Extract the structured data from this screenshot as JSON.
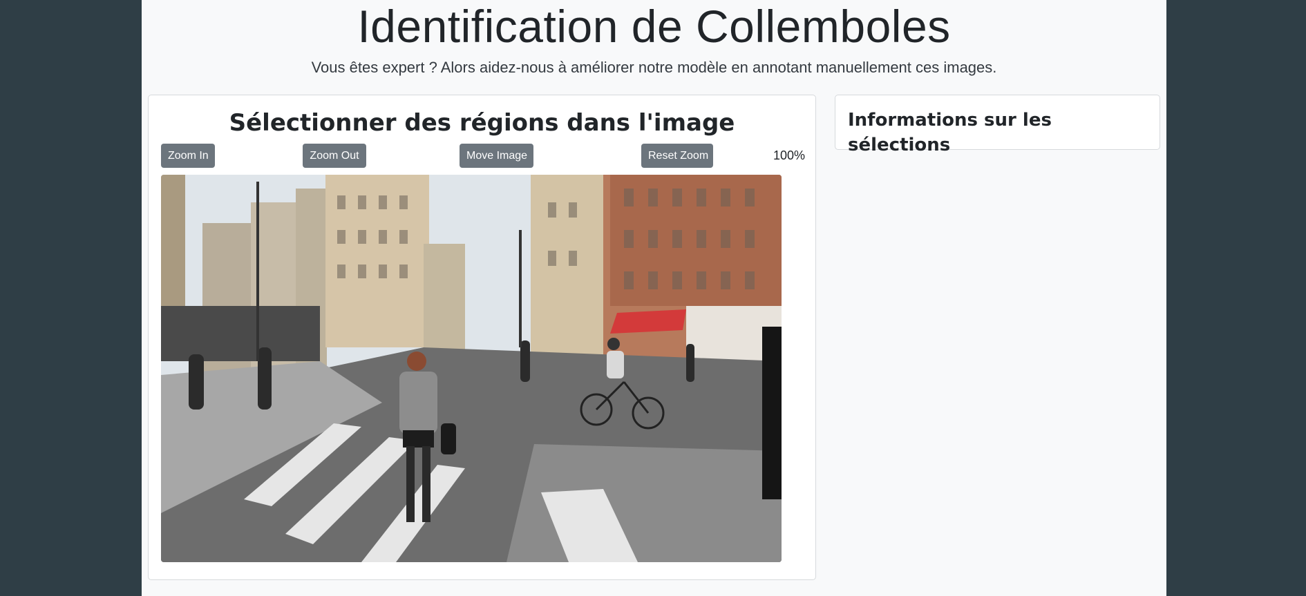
{
  "header": {
    "title": "Identification de Collemboles",
    "subtitle": "Vous êtes expert ? Alors aidez-nous à améliorer notre modèle en annotant manuellement ces images."
  },
  "selection_panel": {
    "title": "Sélectionner des régions dans l'image",
    "toolbar": {
      "zoom_in_label": "Zoom In",
      "zoom_out_label": "Zoom Out",
      "move_image_label": "Move Image",
      "reset_zoom_label": "Reset Zoom",
      "zoom_level": "100%"
    },
    "image": {
      "subject": "street-scene-photo"
    }
  },
  "info_panel": {
    "title": "Informations sur les sélections"
  },
  "colors": {
    "background": "#2f3e46",
    "page": "#f8f9fa",
    "button": "#6c757d",
    "button_text": "#ffffff"
  }
}
